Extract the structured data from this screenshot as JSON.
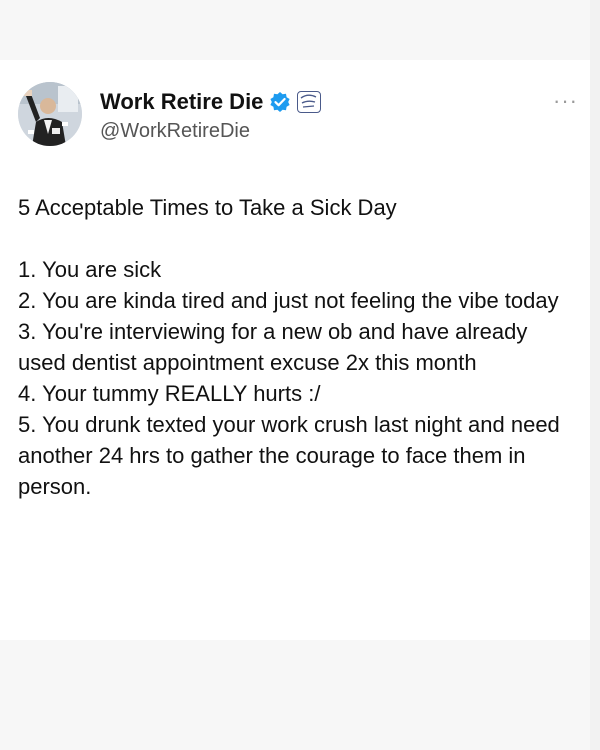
{
  "account": {
    "display_name": "Work Retire Die",
    "handle": "@WorkRetireDie",
    "verified_icon": "verified-check-icon",
    "affiliate_badge_icon": "organization-badge-icon"
  },
  "more_button": {
    "label": "···",
    "icon": "more-options-icon"
  },
  "tweet": {
    "title": "5 Acceptable Times to Take a Sick Day",
    "items": [
      "1. You are sick",
      "2. You are kinda tired and just not feeling the vibe today",
      "3. You're interviewing for a new ob and have already used dentist appointment excuse 2x this month",
      "4. Your tummy REALLY hurts :/",
      "5. You drunk texted your work crush last night and need another 24 hrs to gather the courage to face them in person."
    ]
  },
  "colors": {
    "background": "#f7f7f7",
    "card": "#ffffff",
    "text": "#111111",
    "muted": "#555555",
    "verified_blue": "#1d9bf0"
  }
}
